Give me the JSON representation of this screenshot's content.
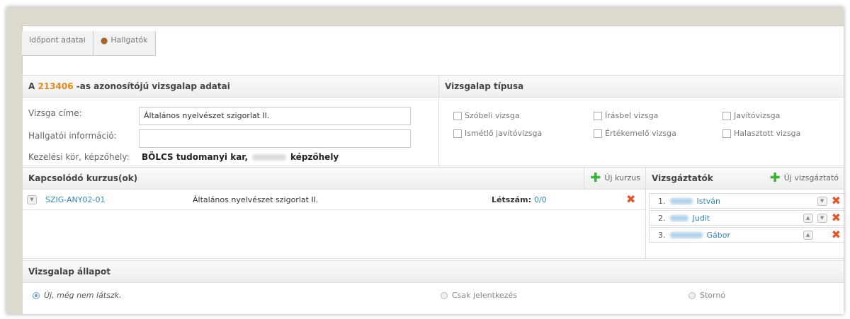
{
  "tabs": [
    {
      "label": "ldőpont adatai"
    },
    {
      "label": "Hallgatók",
      "icon": "users-icon"
    }
  ],
  "details": {
    "title_prefix": "A",
    "id_number": "213406",
    "title_suffix": "-as azonosítójú vizsgalap adatai",
    "exam_title_label": "Vizsga címe:",
    "exam_title_value": "Általános nyelvészet szigorlat II.",
    "student_info_label": "Hallgatói információ:",
    "student_info_value": "",
    "scope_label": "Kezelési kör, képzőhely:",
    "scope_value_1": "BÖLCS tudomanyi kar,",
    "scope_value_2": "képzőhely"
  },
  "type_box": {
    "title": "Vizsgalap típusa",
    "options": [
      "Szóbeli vizsga",
      "Írásbel vizsga",
      "Javítóvizsga",
      "Ismétlő javítóvizsga",
      "Értékemelő vizsga",
      "Halasztott vizsga"
    ]
  },
  "courses": {
    "title": "Kapcsolódó kurzus(ok)",
    "add_label": "Új kurzus",
    "row": {
      "code": "SZIG-ANY02-01",
      "name": "Általános nyelvészet szigorlat II.",
      "count_label": "Létszám:",
      "count_value": "0/0"
    }
  },
  "examiners": {
    "title": "Vizsgáztatók",
    "add_label": "Új vizsgáztató",
    "items": [
      {
        "index": "1.",
        "name": "István"
      },
      {
        "index": "2.",
        "name": "Judit"
      },
      {
        "index": "3.",
        "name": "Gábor"
      }
    ]
  },
  "status": {
    "title": "Vizsgalap állapot",
    "options": [
      {
        "label": "Új, még nem látszk.",
        "selected": true
      },
      {
        "label": "Csak jelentkezés",
        "selected": false
      },
      {
        "label": "Stornó",
        "selected": false
      }
    ]
  },
  "colors": {
    "accent_orange": "#e3891b",
    "link_blue": "#2e88b6",
    "delete_red": "#e2552b",
    "add_green": "#3db33d"
  }
}
